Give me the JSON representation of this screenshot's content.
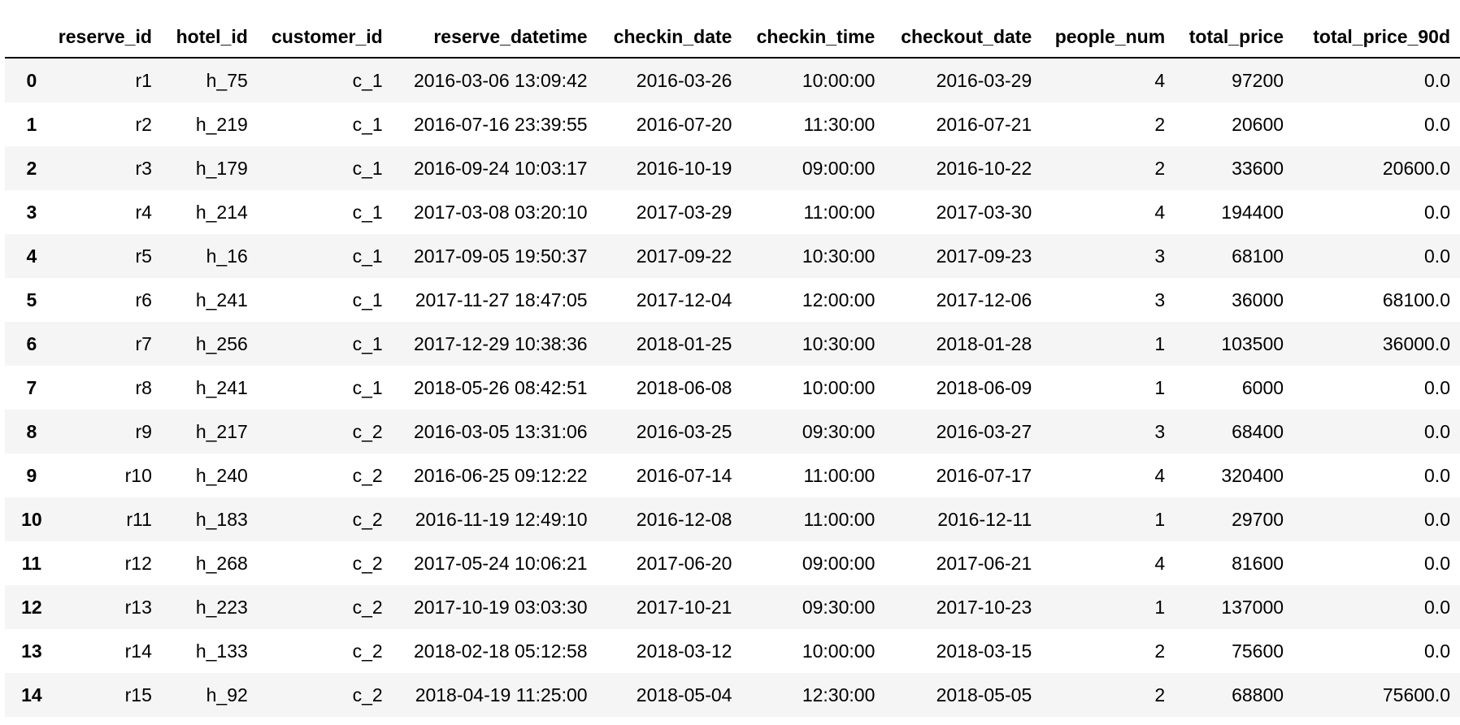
{
  "table": {
    "index_header": "",
    "columns": [
      "reserve_id",
      "hotel_id",
      "customer_id",
      "reserve_datetime",
      "checkin_date",
      "checkin_time",
      "checkout_date",
      "people_num",
      "total_price",
      "total_price_90d"
    ],
    "rows": [
      {
        "index": "0",
        "cells": [
          "r1",
          "h_75",
          "c_1",
          "2016-03-06 13:09:42",
          "2016-03-26",
          "10:00:00",
          "2016-03-29",
          "4",
          "97200",
          "0.0"
        ]
      },
      {
        "index": "1",
        "cells": [
          "r2",
          "h_219",
          "c_1",
          "2016-07-16 23:39:55",
          "2016-07-20",
          "11:30:00",
          "2016-07-21",
          "2",
          "20600",
          "0.0"
        ]
      },
      {
        "index": "2",
        "cells": [
          "r3",
          "h_179",
          "c_1",
          "2016-09-24 10:03:17",
          "2016-10-19",
          "09:00:00",
          "2016-10-22",
          "2",
          "33600",
          "20600.0"
        ]
      },
      {
        "index": "3",
        "cells": [
          "r4",
          "h_214",
          "c_1",
          "2017-03-08 03:20:10",
          "2017-03-29",
          "11:00:00",
          "2017-03-30",
          "4",
          "194400",
          "0.0"
        ]
      },
      {
        "index": "4",
        "cells": [
          "r5",
          "h_16",
          "c_1",
          "2017-09-05 19:50:37",
          "2017-09-22",
          "10:30:00",
          "2017-09-23",
          "3",
          "68100",
          "0.0"
        ]
      },
      {
        "index": "5",
        "cells": [
          "r6",
          "h_241",
          "c_1",
          "2017-11-27 18:47:05",
          "2017-12-04",
          "12:00:00",
          "2017-12-06",
          "3",
          "36000",
          "68100.0"
        ]
      },
      {
        "index": "6",
        "cells": [
          "r7",
          "h_256",
          "c_1",
          "2017-12-29 10:38:36",
          "2018-01-25",
          "10:30:00",
          "2018-01-28",
          "1",
          "103500",
          "36000.0"
        ]
      },
      {
        "index": "7",
        "cells": [
          "r8",
          "h_241",
          "c_1",
          "2018-05-26 08:42:51",
          "2018-06-08",
          "10:00:00",
          "2018-06-09",
          "1",
          "6000",
          "0.0"
        ]
      },
      {
        "index": "8",
        "cells": [
          "r9",
          "h_217",
          "c_2",
          "2016-03-05 13:31:06",
          "2016-03-25",
          "09:30:00",
          "2016-03-27",
          "3",
          "68400",
          "0.0"
        ]
      },
      {
        "index": "9",
        "cells": [
          "r10",
          "h_240",
          "c_2",
          "2016-06-25 09:12:22",
          "2016-07-14",
          "11:00:00",
          "2016-07-17",
          "4",
          "320400",
          "0.0"
        ]
      },
      {
        "index": "10",
        "cells": [
          "r11",
          "h_183",
          "c_2",
          "2016-11-19 12:49:10",
          "2016-12-08",
          "11:00:00",
          "2016-12-11",
          "1",
          "29700",
          "0.0"
        ]
      },
      {
        "index": "11",
        "cells": [
          "r12",
          "h_268",
          "c_2",
          "2017-05-24 10:06:21",
          "2017-06-20",
          "09:00:00",
          "2017-06-21",
          "4",
          "81600",
          "0.0"
        ]
      },
      {
        "index": "12",
        "cells": [
          "r13",
          "h_223",
          "c_2",
          "2017-10-19 03:03:30",
          "2017-10-21",
          "09:30:00",
          "2017-10-23",
          "1",
          "137000",
          "0.0"
        ]
      },
      {
        "index": "13",
        "cells": [
          "r14",
          "h_133",
          "c_2",
          "2018-02-18 05:12:58",
          "2018-03-12",
          "10:00:00",
          "2018-03-15",
          "2",
          "75600",
          "0.0"
        ]
      },
      {
        "index": "14",
        "cells": [
          "r15",
          "h_92",
          "c_2",
          "2018-04-19 11:25:00",
          "2018-05-04",
          "12:30:00",
          "2018-05-05",
          "2",
          "68800",
          "75600.0"
        ]
      }
    ]
  }
}
